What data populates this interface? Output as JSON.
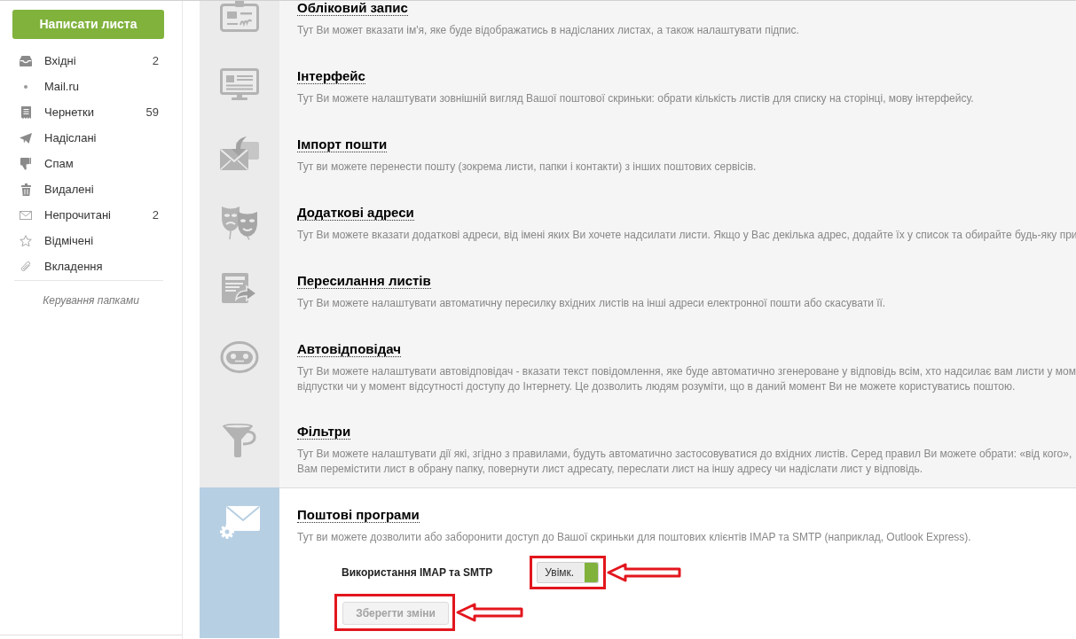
{
  "compose_button": {
    "label": "Написати листа"
  },
  "folders": [
    {
      "label": "Вхідні",
      "count": "2"
    },
    {
      "label": "Mail.ru"
    },
    {
      "label": "Чернетки",
      "count": "59"
    },
    {
      "label": "Надіслані"
    },
    {
      "label": "Спам"
    },
    {
      "label": "Видалені"
    },
    {
      "label": "Непрочитані",
      "count": "2"
    },
    {
      "label": "Відмічені"
    },
    {
      "label": "Вкладення"
    }
  ],
  "manage_folders_link": "Керування папками",
  "settings_sections": [
    {
      "title": "Обліковий запис",
      "selected": false,
      "description_lines": [
        "Тут Ви может вказати ім'я, яке буде відображатись в надісланих листах, а також налаштувати підпис."
      ]
    },
    {
      "title": "Інтерфейс",
      "selected": false,
      "description_lines": [
        "Тут Ви можете налаштувати зовнішній вигляд Вашої поштової скриньки: обрати кількість листів для списку на сторінці, мову інтерфейсу."
      ]
    },
    {
      "title": "Імпорт пошти",
      "selected": false,
      "description_lines": [
        "Тут ви можете перенести пошту (зокрема листи, папки і контакти) з інших поштових сервісів."
      ]
    },
    {
      "title": "Додаткові адреси",
      "selected": false,
      "description_lines": [
        "Тут Ви можете вказати додаткові адреси, від імені яких Ви хочете надсилати листи. Якщо у Вас декілька адрес, додайте їх у список та обирайте будь-яку при"
      ]
    },
    {
      "title": "Пересилання листів",
      "selected": false,
      "description_lines": [
        "Тут Ви можете налаштувати автоматичну пересилку вхідних листів на інші адреси електронної пошти або скасувати її."
      ]
    },
    {
      "title": "Автовідповідач",
      "selected": false,
      "description_lines": [
        "Тут Ви можете налаштувати автовідповідач - вказати текст повідомлення, яке буде автоматично згенероване у відповідь всім, хто надсилає вам листи у мом",
        "відпустки чи у момент відсутності доступу до Інтернету. Це дозволить людям розуміти, що в даний момент Ви не можете користуватись поштою."
      ]
    },
    {
      "title": "Фільтри",
      "selected": false,
      "description_lines": [
        "Тут Ви можете налаштувати дії які, згідно з правилами, будуть автоматично застосовуватися до вхідних листів. Серед правил Ви можете обрати: «від кого»,",
        "Вам перемістити лист в обрану папку, повернути лист адресату, переслати лист на іншу адресу чи надіслати лист у відповідь."
      ]
    },
    {
      "title": "Поштові програми",
      "selected": true,
      "description_lines": [
        "Тут ви можете дозволити або заборонити доступ до Вашої скриньки для поштових клієнтів IMAP та SMTP (наприклад, Outlook Express)."
      ],
      "setting": {
        "label": "Використання IMAP та SMTP",
        "toggle": {
          "label": "Увімк.",
          "on": true,
          "highlighted": true
        }
      },
      "save_button": {
        "label": "Зберегти зміни",
        "disabled": true,
        "highlighted": true
      }
    }
  ]
}
